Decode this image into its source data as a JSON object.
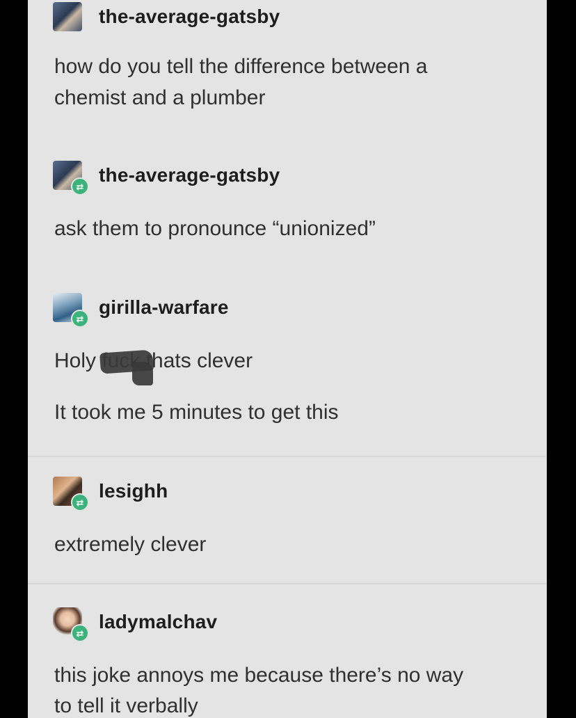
{
  "posts": [
    {
      "username": "the-average-gatsby",
      "reblog": false,
      "lines": [
        "how do you tell the difference between a",
        "chemist and a plumber"
      ]
    },
    {
      "username": "the-average-gatsby",
      "reblog": true,
      "lines": [
        "ask them to pronounce “unionized”"
      ]
    },
    {
      "username": "girilla-warfare",
      "reblog": true,
      "lines": [
        "Holy fuck thats clever",
        "It took me 5 minutes to get this"
      ]
    },
    {
      "username": "lesighh",
      "reblog": true,
      "lines": [
        "extremely clever"
      ]
    },
    {
      "username": "ladymalchav",
      "reblog": true,
      "lines": [
        "this joke annoys me because there’s no way",
        "to tell it verbally"
      ]
    }
  ],
  "icons": {
    "reblog": "reblog-icon"
  },
  "colors": {
    "background": "#e4e4e4",
    "reblog_badge": "#3bb37a",
    "username": "#1d1d1d",
    "text": "#303030"
  }
}
